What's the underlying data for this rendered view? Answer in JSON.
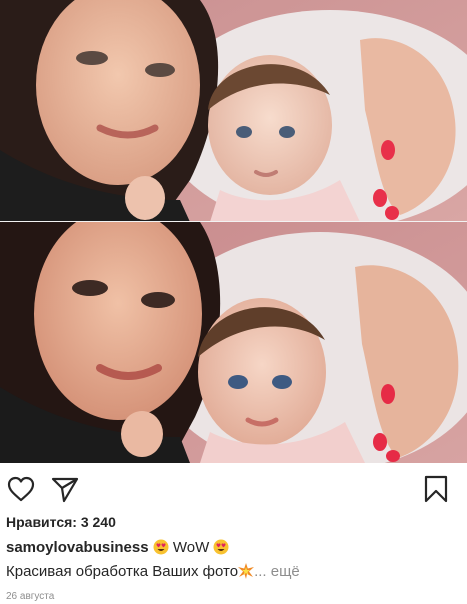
{
  "post": {
    "likes_text": "Нравится: 3 240",
    "username": "samoylovabusiness",
    "caption_part1": "WoW",
    "caption_line2": "Красивая обработка Ваших фото",
    "more_label": "... ещё",
    "date": "26 августа"
  },
  "icons": {
    "like": "heart-outline-icon",
    "share": "paper-plane-icon",
    "save": "bookmark-icon",
    "emoji": "heart-eyes-emoji",
    "spark": "sparkle-emoji"
  },
  "colors": {
    "text": "#262626",
    "muted": "#8e8e8e",
    "background": "#ffffff"
  }
}
